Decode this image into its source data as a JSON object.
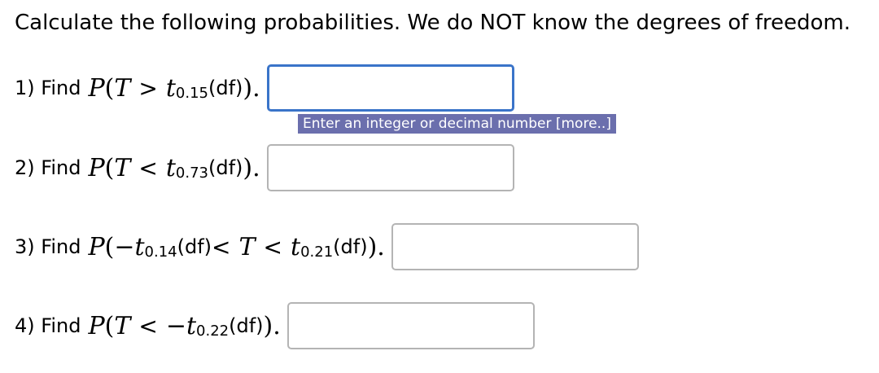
{
  "instructions": "Calculate the following probabilities. We do NOT know the degrees of freedom.",
  "questions": [
    {
      "label": "1) Find",
      "P": "P",
      "open": "(",
      "T": "T",
      "rel": ">",
      "t": "t",
      "sub": "0.15",
      "df": "(df)",
      "close": ")",
      "period": ".",
      "value": ""
    },
    {
      "label": "2) Find",
      "P": "P",
      "open": "(",
      "T": "T",
      "rel": "<",
      "t": "t",
      "sub": "0.73",
      "df": "(df)",
      "close": ")",
      "period": ".",
      "value": ""
    },
    {
      "label": "3) Find",
      "P": "P",
      "open": "(",
      "neg": "−",
      "t1": "t",
      "sub1": "0.14",
      "df1": "(df)",
      "rel1": "<",
      "T": "T",
      "rel2": "<",
      "t2": "t",
      "sub2": "0.21",
      "df2": "(df)",
      "close": ")",
      "period": ".",
      "value": ""
    },
    {
      "label": "4) Find",
      "P": "P",
      "open": "(",
      "T": "T",
      "rel": "<",
      "neg": "−",
      "t": "t",
      "sub": "0.22",
      "df": "(df)",
      "close": ")",
      "period": ".",
      "value": ""
    }
  ],
  "hint": "Enter an integer or decimal number [more..]",
  "colors": {
    "focus_border": "#3a74c9",
    "input_border": "#b4b4b4",
    "hint_background": "#6b6fad",
    "hint_text": "#ffffff"
  }
}
